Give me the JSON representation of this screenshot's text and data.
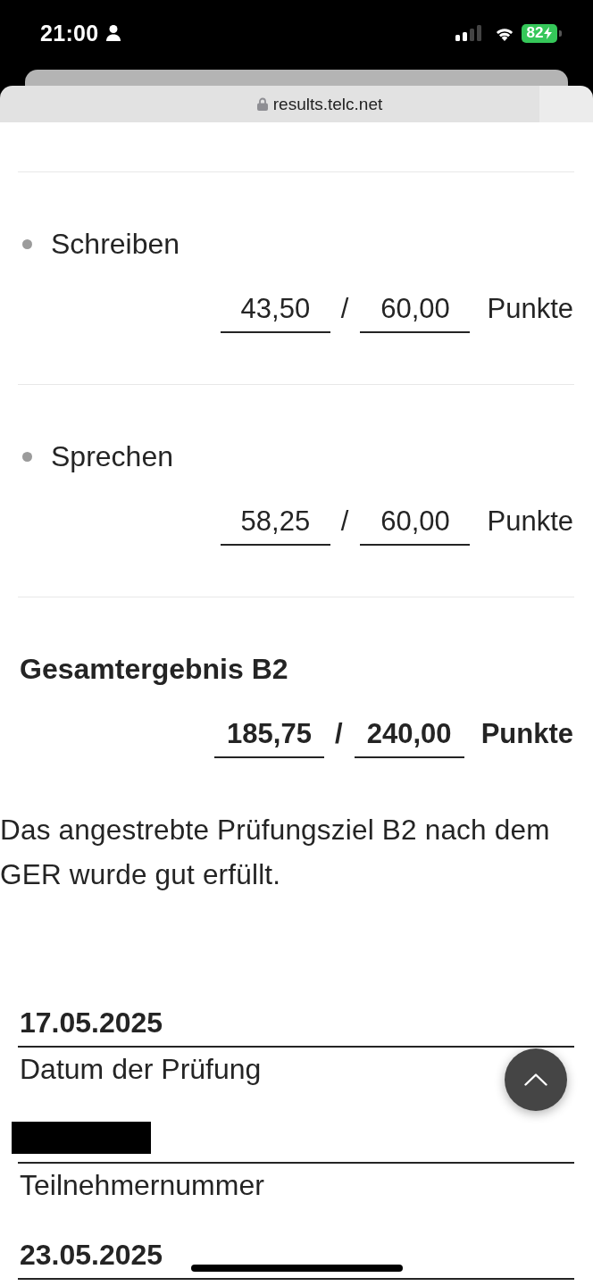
{
  "status_bar": {
    "time": "21:00",
    "battery": "82",
    "charging": true
  },
  "browser": {
    "url": "results.telc.net"
  },
  "results": [
    {
      "kind": "subtest",
      "title": "Schreiben",
      "score": "43,50",
      "separator": "/",
      "max": "60,00",
      "unit": "Punkte"
    },
    {
      "kind": "subtest",
      "title": "Sprechen",
      "score": "58,25",
      "separator": "/",
      "max": "60,00",
      "unit": "Punkte"
    },
    {
      "kind": "total",
      "title": "Gesamtergebnis B2",
      "score": "185,75",
      "separator": "/",
      "max": "240,00",
      "unit": "Punkte"
    }
  ],
  "verdict": "Das angestrebte Prüfungsziel B2 nach dem GER wurde gut erfüllt.",
  "fields": [
    {
      "redacted": false,
      "value": "17.05.2025",
      "label": "Datum der Prüfung"
    },
    {
      "redacted": true,
      "label": "Teilnehmernummer"
    },
    {
      "redacted": false,
      "value": "23.05.2025"
    }
  ]
}
